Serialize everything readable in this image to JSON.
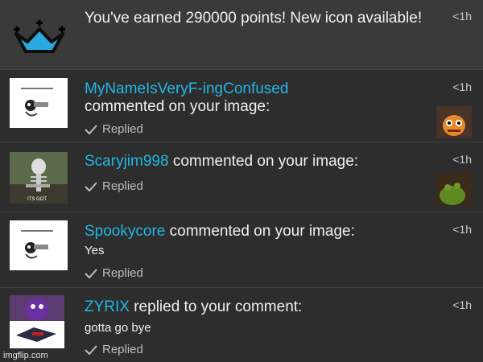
{
  "notifications": [
    {
      "text": "You've earned 290000 points! New icon available!",
      "time": "<1h",
      "icon": "crown-icon"
    },
    {
      "username": "MyNameIsVeryF-ingConfused",
      "action": "commented on your image:",
      "status": "Replied",
      "time": "<1h"
    },
    {
      "username": "Scaryjim998",
      "action": "commented on your image:",
      "status": "Replied",
      "time": "<1h"
    },
    {
      "username": "Spookycore",
      "action": "commented on your image:",
      "comment": "Yes",
      "status": "Replied",
      "time": "<1h"
    },
    {
      "username": "ZYRIX",
      "action": "replied to your comment:",
      "comment": "gotta go bye",
      "status": "Replied",
      "time": "<1h"
    }
  ],
  "watermark": "imgflip.com",
  "colors": {
    "background": "#2d2d2d",
    "username": "#21b7e6",
    "crown": "#29a8e0"
  }
}
